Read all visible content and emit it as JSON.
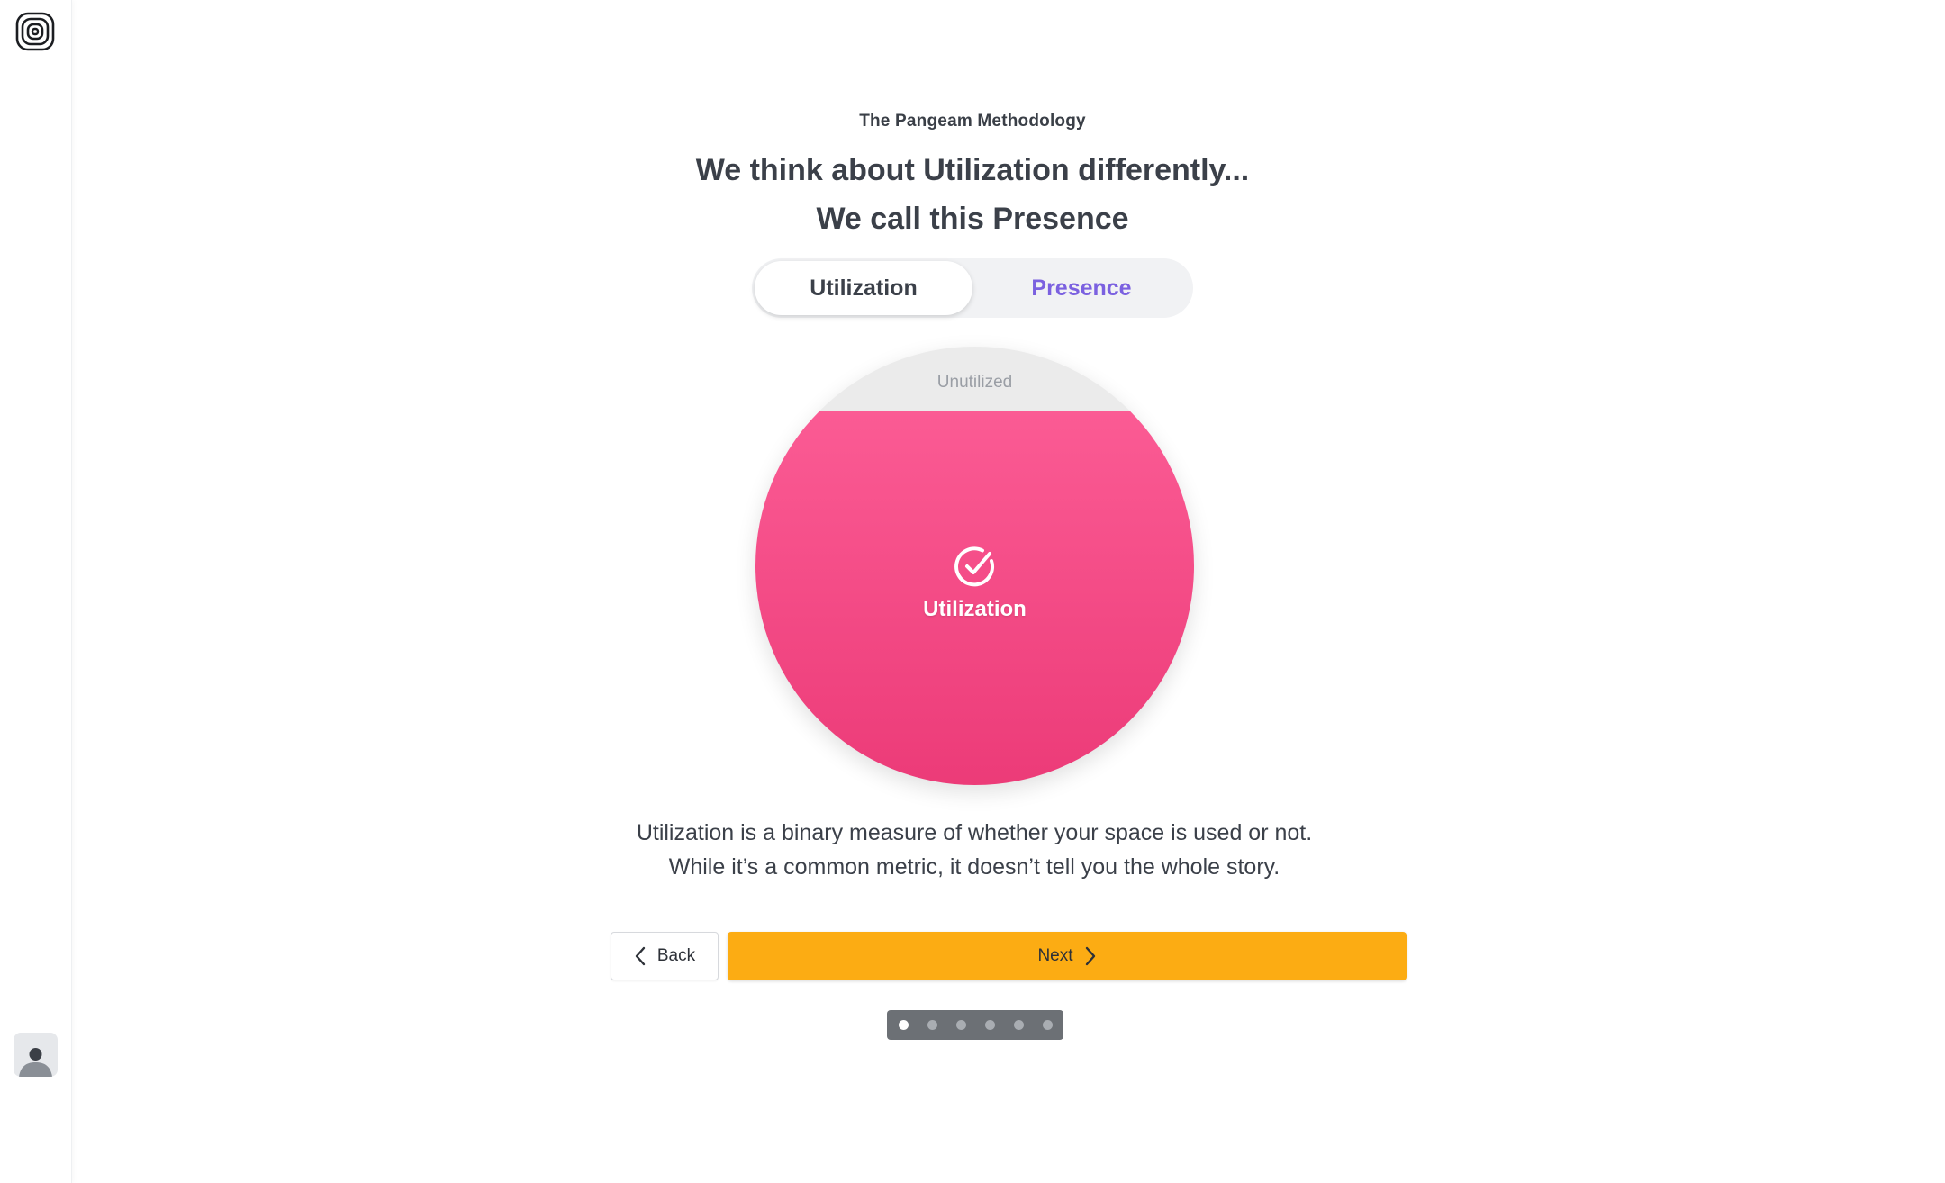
{
  "header": {
    "eyebrow": "The Pangeam Methodology",
    "title_line1": "We think about Utilization differently...",
    "title_line2": "We call this Presence"
  },
  "toggle": {
    "options": [
      {
        "label": "Utilization",
        "active": true
      },
      {
        "label": "Presence",
        "active": false
      }
    ]
  },
  "visual": {
    "unutilized_label": "Unutilized",
    "utilized_label": "Utilization",
    "utilized_fraction": 0.852,
    "fill_color_top": "#fb5b94",
    "fill_color_bottom": "#ec3b78",
    "empty_color": "#ebebeb",
    "icon": "check-circle-icon"
  },
  "description": {
    "line1": "Utilization is a binary measure of whether your space is used or not.",
    "line2": "While it’s a common metric, it doesn’t tell you the whole story."
  },
  "nav": {
    "back_label": "Back",
    "next_label": "Next",
    "next_color": "#fcac13"
  },
  "pagination": {
    "total": 6,
    "current": 1
  },
  "sidebar": {
    "logo_icon": "concentric-squares-logo-icon",
    "avatar_icon": "user-avatar-icon"
  }
}
